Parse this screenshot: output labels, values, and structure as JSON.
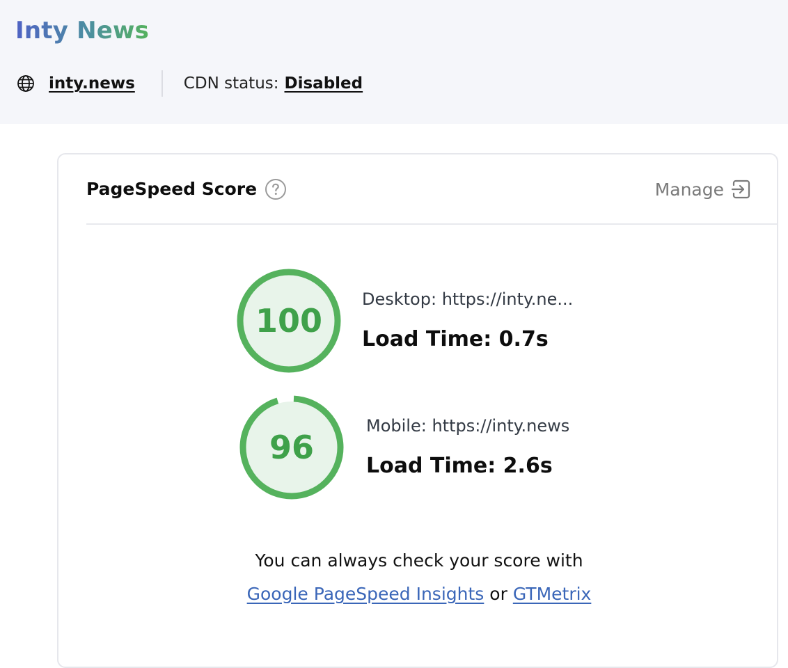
{
  "header": {
    "site_title": "Inty News",
    "site_link": "inty.news",
    "cdn_label": "CDN status:",
    "cdn_value": "Disabled",
    "globe_icon": "globe-icon"
  },
  "card": {
    "title": "PageSpeed Score",
    "help_icon": "question-circle-icon",
    "manage_label": "Manage",
    "manage_icon": "exit-arrow-icon"
  },
  "scores": {
    "desktop": {
      "score": "100",
      "fraction": 1.0,
      "url_text": "Desktop: https://inty.ne...",
      "load_time": "Load Time: 0.7s"
    },
    "mobile": {
      "score": "96",
      "fraction": 0.96,
      "url_text": "Mobile: https://inty.news",
      "load_time": "Load Time: 2.6s"
    }
  },
  "footer": {
    "text_line1": "You can always check your score with",
    "link1": "Google PageSpeed Insights",
    "or_text": "or",
    "link2": "GTMetrix"
  },
  "colors": {
    "score_ring": "#55b25d",
    "score_fill": "#e8f4ea",
    "link": "#3a66b8"
  }
}
